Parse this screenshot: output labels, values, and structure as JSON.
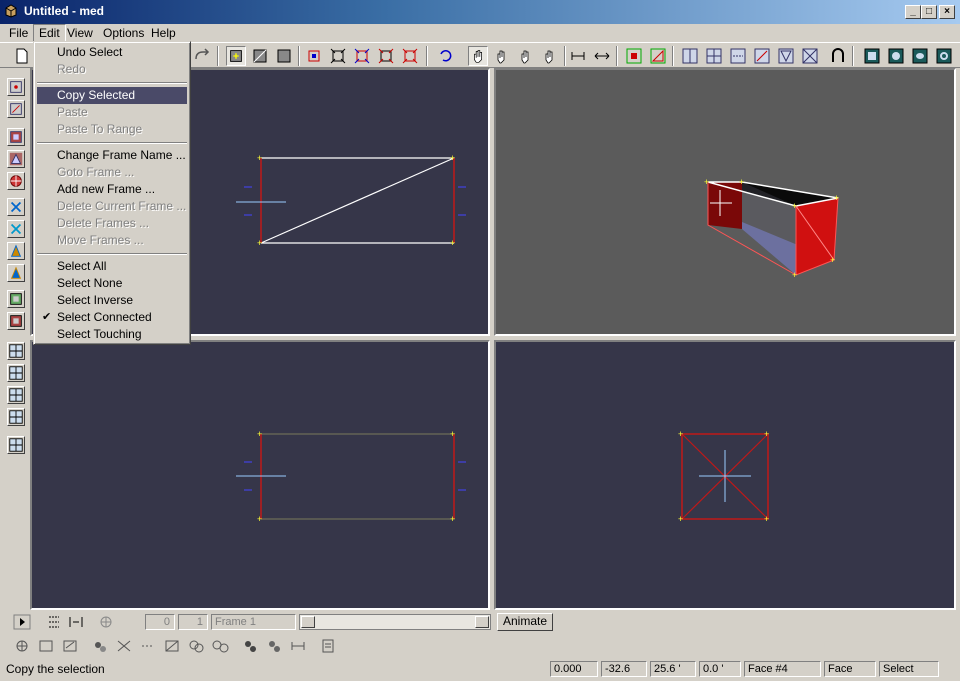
{
  "window": {
    "title": "Untitled - med",
    "minimize": "_",
    "maximize": "□",
    "close": "×"
  },
  "menubar": [
    {
      "label": "File"
    },
    {
      "label": "Edit"
    },
    {
      "label": "View"
    },
    {
      "label": "Options"
    },
    {
      "label": "Help"
    }
  ],
  "edit_menu": {
    "undo": "Undo Select",
    "redo": "Redo",
    "copy": "Copy Selected",
    "paste": "Paste",
    "paste_range": "Paste To Range",
    "change_frame": "Change Frame Name ...",
    "goto_frame": "Goto Frame ...",
    "add_frame": "Add new Frame ...",
    "delete_current": "Delete Current Frame ...",
    "delete_frames": "Delete Frames ...",
    "move_frames": "Move Frames ...",
    "select_all": "Select All",
    "select_none": "Select None",
    "select_inverse": "Select Inverse",
    "select_connected": "Select Connected",
    "select_touching": "Select Touching",
    "checkmark": "✔"
  },
  "animation_bar": {
    "frame_start": "0",
    "frame_end": "1",
    "frame_name": "Frame 1",
    "animate_label": "Animate"
  },
  "status": {
    "message": "Copy the selection",
    "x": "0.000",
    "y": "-32.6",
    "z": "25.6 '",
    "angle": "0.0 '",
    "element": "Face #4",
    "mode": "Face",
    "tool": "Select"
  },
  "colors": {
    "viewport_bg": "#363649",
    "perspective_bg": "#5b5b5b",
    "selection_red": "#cc1111",
    "vertex_yellow": "#ffee33"
  }
}
